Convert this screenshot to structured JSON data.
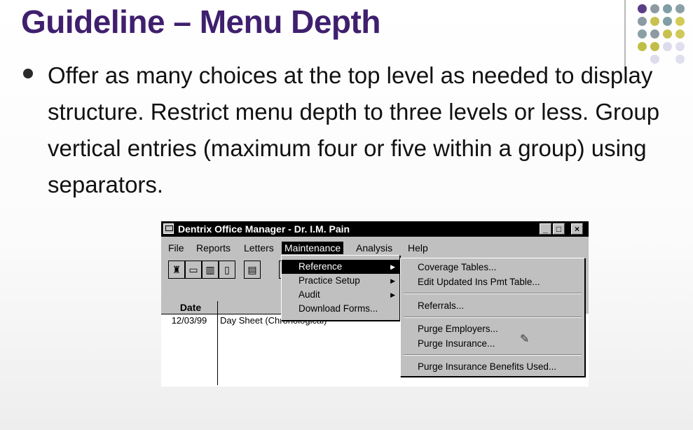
{
  "slide": {
    "title": "Guideline – Menu Depth",
    "bullet": "Offer as many choices at the top level as needed to display structure. Restrict menu depth to three levels or less. Group vertical entries (maximum four or five within a group) using separators."
  },
  "window": {
    "title": "Dentrix Office Manager - Dr. I.M. Pain",
    "controls": {
      "minimize": "_",
      "maximize": "□",
      "close": "×"
    }
  },
  "menubar": {
    "items": [
      "File",
      "Reports",
      "Letters",
      "Maintenance",
      "Analysis",
      "Help"
    ]
  },
  "table": {
    "header_date": "Date",
    "row_date": "12/03/99",
    "row_desc": "Day Sheet (Chronological)"
  },
  "maintenance_menu": {
    "items": [
      "Reference",
      "Practice Setup",
      "Audit",
      "Download Forms..."
    ]
  },
  "reference_submenu": {
    "items": [
      "Coverage Tables...",
      "Edit Updated Ins Pmt Table...",
      "Referrals...",
      "Purge Employers...",
      "Purge Insurance...",
      "Purge Insurance Benefits Used..."
    ]
  },
  "colors": {
    "title": "#3f1f6e",
    "dots": [
      "#5a3d87",
      "#8d9aa3",
      "#7f9ea5",
      "#8aa0a6",
      "#c9c251",
      "#d3cb54",
      "#c8c14e",
      "#d0c95a",
      "#dcdcec",
      "#bfbf47",
      "#c3bc49",
      "#dfdfee"
    ]
  },
  "icons": [
    "tooth-icon",
    "folder-icon",
    "chart-icon",
    "book-icon",
    "printer-icon",
    "pencil-icon"
  ]
}
